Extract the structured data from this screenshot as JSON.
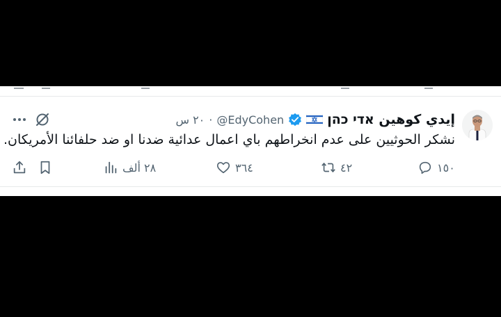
{
  "tweet": {
    "display_name": "إيدي كوهين אדי כהן",
    "handle": "@EdyCohen",
    "separator": "·",
    "time": "٢٠ س",
    "text": "نشكر الحوثيين على عدم انخراطهم باي اعمال عدائية ضدنا او ضد حلفائنا الأمريكان.",
    "flag_icon": "israel-flag-icon",
    "verified_icon": "verified-badge-icon",
    "verified_color": "#1d9bf0"
  },
  "actions": {
    "replies": "١٥٠",
    "retweets": "٤٢",
    "likes": "٣٦٤",
    "views": "٢٨ ألف",
    "icons": [
      "reply-icon",
      "retweet-icon",
      "like-icon",
      "views-icon",
      "bookmark-icon",
      "share-icon"
    ]
  },
  "colors": {
    "text_primary": "#0f1419",
    "text_secondary": "#536471",
    "divider": "#e7e9ea",
    "background": "#ffffff",
    "letterbox": "#000000"
  }
}
